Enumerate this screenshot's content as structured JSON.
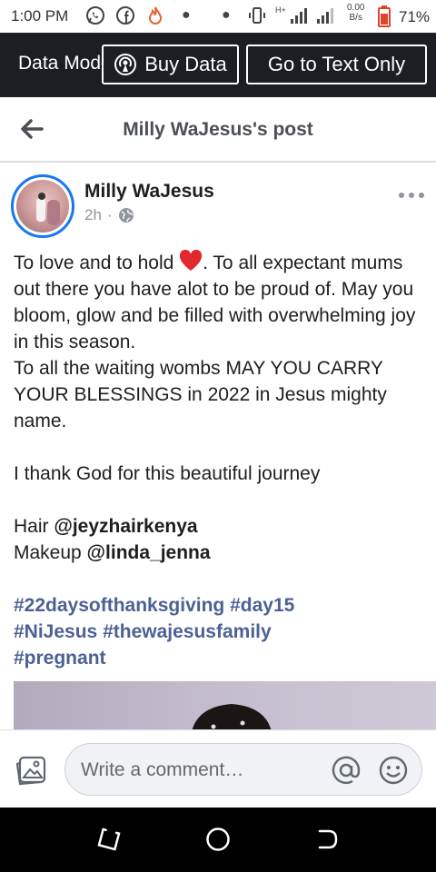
{
  "status_bar": {
    "time": "1:00 PM",
    "net_speed_value": "0.00",
    "net_speed_unit": "B/s",
    "network_type": "H+",
    "battery": "71%",
    "icons": [
      "whatsapp-icon",
      "facebook-icon",
      "tinder-icon",
      "dot",
      "dot",
      "vibrate-icon",
      "signal-icon",
      "signal-icon",
      "battery-icon"
    ]
  },
  "data_bar": {
    "mode_label": "Data Mode",
    "buy_data_label": "Buy Data",
    "text_only_label": "Go to Text Only"
  },
  "header": {
    "title": "Milly WaJesus's post"
  },
  "post": {
    "author": "Milly WaJesus",
    "time_ago": "2h",
    "separator": "·",
    "audience_icon": "globe-icon",
    "lines": {
      "l1a": "To love and to hold ",
      "l1b": ". To all expectant mums out there you have alot to be proud of.  May you bloom, glow and be filled with overwhelming joy in this season.",
      "l2": "To all the waiting wombs MAY YOU CARRY YOUR BLESSINGS in 2022 in Jesus mighty  name.",
      "l3": "I thank God for this beautiful journey",
      "hair_label": "Hair ",
      "hair_handle": "@jeyzhairkenya",
      "makeup_label": "Makeup ",
      "makeup_handle": "@linda_jenna",
      "tag1": "#22daysofthanksgiving",
      "tag2": "#day15",
      "tag3": "#NiJesus",
      "tag4": "#thewajesusfamily",
      "tag5": "#pregnant"
    }
  },
  "comment_bar": {
    "placeholder": "Write a comment…"
  },
  "colors": {
    "accent": "#1877f2",
    "hashtag": "#4b6195",
    "dark_bar": "#1b1e23"
  }
}
